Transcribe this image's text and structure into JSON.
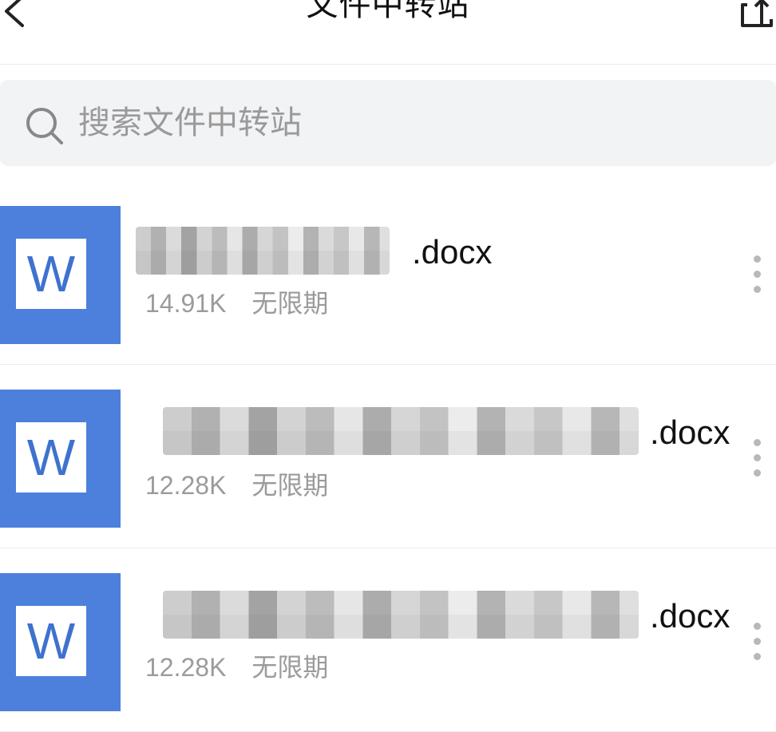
{
  "header": {
    "title": "文件中转站",
    "back_icon": "chevron-left-icon",
    "upload_icon": "upload-icon"
  },
  "search": {
    "placeholder": "搜索文件中转站",
    "icon": "search-icon"
  },
  "files": [
    {
      "extension": ".docx",
      "size": "14.91K",
      "expiry": "无限期",
      "icon_letter": "W",
      "icon_color": "#4c80dc"
    },
    {
      "extension": ".docx",
      "size": "12.28K",
      "expiry": "无限期",
      "icon_letter": "W",
      "icon_color": "#4c80dc"
    },
    {
      "extension": ".docx",
      "size": "12.28K",
      "expiry": "无限期",
      "icon_letter": "W",
      "icon_color": "#4c80dc"
    }
  ]
}
